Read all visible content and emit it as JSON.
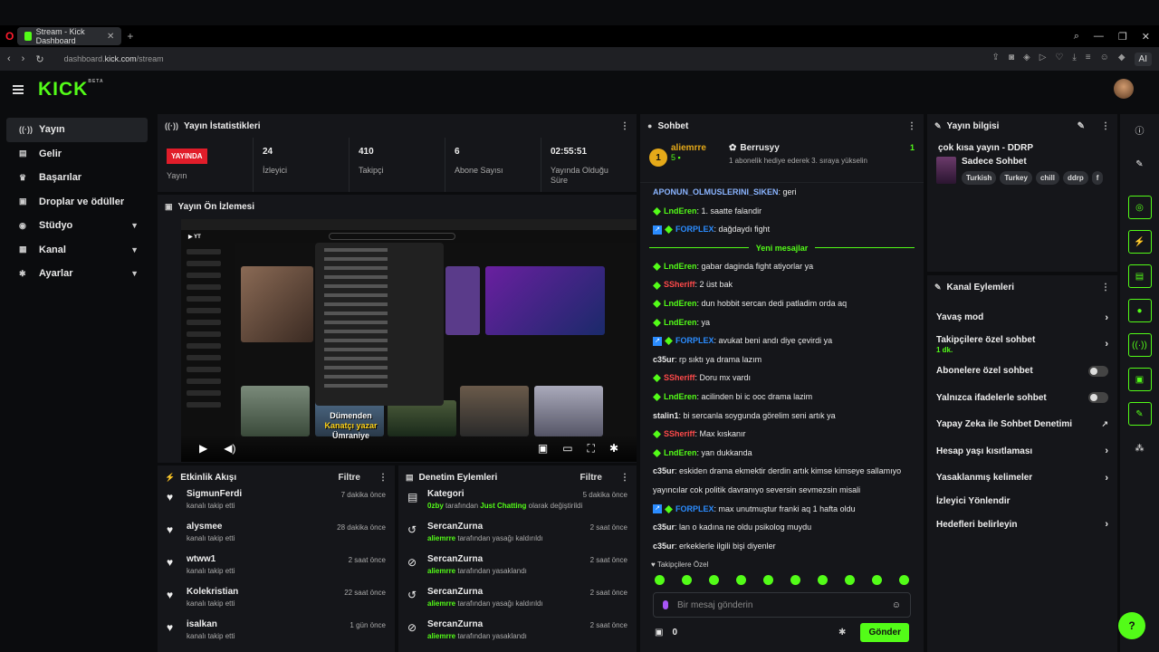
{
  "browser": {
    "tab_title": "Stream - Kick Dashboard",
    "url_prefix": "dashboard.",
    "url_domain": "kick.com",
    "url_path": "/stream",
    "ai_label": "AI"
  },
  "app": {
    "logo": "KICK",
    "logo_sup": "BETA"
  },
  "sidebar": {
    "items": [
      {
        "label": "Yayın",
        "icon": "broadcast-icon"
      },
      {
        "label": "Gelir",
        "icon": "revenue-icon"
      },
      {
        "label": "Başarılar",
        "icon": "trophy-icon"
      },
      {
        "label": "Droplar ve ödüller",
        "icon": "gift-icon"
      },
      {
        "label": "Stüdyo",
        "icon": "studio-icon"
      },
      {
        "label": "Kanal",
        "icon": "channel-icon"
      },
      {
        "label": "Ayarlar",
        "icon": "gear-icon"
      }
    ]
  },
  "stats": {
    "title": "Yayın İstatistikleri",
    "live_badge": "YAYINDA",
    "live_label": "Yayın",
    "viewers_value": "24",
    "viewers_label": "İzleyici",
    "followers_value": "410",
    "followers_label": "Takipçi",
    "subs_value": "6",
    "subs_label": "Abone Sayısı",
    "duration_value": "02:55:51",
    "duration_label": "Yayında Olduğu Süre"
  },
  "preview": {
    "title": "Yayın Ön İzlemesi",
    "overlay_line1": "Dümenden",
    "overlay_line2": "Kanatçı yazar",
    "overlay_line3": "Ümraniye"
  },
  "activity": {
    "title": "Etkinlik Akışı",
    "filter": "Filtre",
    "items": [
      {
        "name": "SigmunFerdi",
        "sub": "kanalı takip etti",
        "time": "7 dakika önce"
      },
      {
        "name": "alysmee",
        "sub": "kanalı takip etti",
        "time": "28 dakika önce"
      },
      {
        "name": "wtww1",
        "sub": "kanalı takip etti",
        "time": "2 saat önce"
      },
      {
        "name": "Kolekristian",
        "sub": "kanalı takip etti",
        "time": "22 saat önce"
      },
      {
        "name": "isalkan",
        "sub": "kanalı takip etti",
        "time": "1 gün önce"
      }
    ]
  },
  "moderation": {
    "title": "Denetim Eylemleri",
    "filter": "Filtre",
    "items": [
      {
        "name": "Kategori",
        "actor": "0zby",
        "mid": "tarafından",
        "target": "Just Chatting",
        "rest": "olarak değiştirildi",
        "time": "5 dakika önce"
      },
      {
        "name": "SercanZurna",
        "actor": "aliemrre",
        "mid": "tarafından yasağı kaldırıldı",
        "target": "",
        "rest": "",
        "time": "2 saat önce"
      },
      {
        "name": "SercanZurna",
        "actor": "aliemrre",
        "mid": "tarafından yasaklandı",
        "target": "",
        "rest": "",
        "time": "2 saat önce"
      },
      {
        "name": "SercanZurna",
        "actor": "aliemrre",
        "mid": "tarafından yasağı kaldırıldı",
        "target": "",
        "rest": "",
        "time": "2 saat önce"
      },
      {
        "name": "SercanZurna",
        "actor": "aliemrre",
        "mid": "tarafından yasaklandı",
        "target": "",
        "rest": "",
        "time": "2 saat önce"
      }
    ]
  },
  "chat": {
    "title": "Sohbet",
    "pin_rank": "1",
    "pin_user": "aliemrre",
    "pin_user_count": "5",
    "pin_gifter": "Berrusyy",
    "pin_gifter_count": "1",
    "pin_text": "1 abonelik hediye ederek 3. sıraya yükselin",
    "new_messages": "Yeni mesajlar",
    "followers_only": "Takipçilere Özel",
    "placeholder": "Bir mesaj gönderin",
    "gift_count": "0",
    "send": "Gönder",
    "messages_before": [
      {
        "user": "APONUN_OLMUSLERINI_SIKEN",
        "color": "u-cyan",
        "badges": "",
        "text": "geri"
      },
      {
        "user": "LndEren",
        "color": "u-green",
        "badges": "g",
        "text": "1. saatte falandir"
      },
      {
        "user": "FORPLEX",
        "color": "u-blue",
        "badges": "bg",
        "text": "dağdaydı fight"
      }
    ],
    "messages_after": [
      {
        "user": "LndEren",
        "color": "u-green",
        "badges": "g",
        "text": "gabar daginda fight atiyorlar ya"
      },
      {
        "user": "SSheriff",
        "color": "u-red",
        "badges": "g",
        "text": "2 üst bak"
      },
      {
        "user": "LndEren",
        "color": "u-green",
        "badges": "g",
        "text": "dun hobbit sercan dedi patladim orda aq"
      },
      {
        "user": "LndEren",
        "color": "u-green",
        "badges": "g",
        "text": "ya"
      },
      {
        "user": "FORPLEX",
        "color": "u-blue",
        "badges": "bg",
        "text": "avukat beni andı diye çevirdi ya"
      },
      {
        "user": "c35ur",
        "color": "u-white",
        "badges": "",
        "text": "rp sıktı ya drama lazım"
      },
      {
        "user": "SSheriff",
        "color": "u-red",
        "badges": "g",
        "text": "Doru mx vardı"
      },
      {
        "user": "LndEren",
        "color": "u-green",
        "badges": "g",
        "text": "acilinden bi ic ooc drama lazim"
      },
      {
        "user": "stalin1",
        "color": "u-white",
        "badges": "",
        "text": "bi sercanla soygunda görelim seni artık ya"
      },
      {
        "user": "SSheriff",
        "color": "u-red",
        "badges": "g",
        "text": "Max kıskanır"
      },
      {
        "user": "LndEren",
        "color": "u-green",
        "badges": "g",
        "text": "yan dukkanda"
      },
      {
        "user": "c35ur",
        "color": "u-white",
        "badges": "",
        "text": "eskiden drama ekmektir derdin artık kimse kimseye sallamıyo"
      },
      {
        "user": "",
        "color": "u-white",
        "badges": "",
        "text": "yayıncılar cok politik davranıyo seversin sevmezsin misali"
      },
      {
        "user": "FORPLEX",
        "color": "u-blue",
        "badges": "bg",
        "text": "max unutmuştur franki aq 1 hafta oldu"
      },
      {
        "user": "c35ur",
        "color": "u-white",
        "badges": "",
        "text": "lan o kadına ne oldu psikolog muydu"
      },
      {
        "user": "c35ur",
        "color": "u-white",
        "badges": "",
        "text": "erkeklerle ilgili bişi diyenler"
      }
    ]
  },
  "stream_info": {
    "title": "Yayın bilgisi",
    "stream_title": "çok kısa yayın - DDRP",
    "category": "Sadece Sohbet",
    "tags": [
      "Turkish",
      "Turkey",
      "chill",
      "ddrp",
      "f"
    ]
  },
  "channel_actions": {
    "title": "Kanal Eylemleri",
    "items": [
      {
        "label": "Yavaş mod",
        "sub": "",
        "control": "chevron"
      },
      {
        "label": "Takipçilere özel sohbet",
        "sub": "1 dk.",
        "control": "chevron"
      },
      {
        "label": "Abonelere özel sohbet",
        "sub": "",
        "control": "toggle"
      },
      {
        "label": "Yalnızca ifadelerle sohbet",
        "sub": "",
        "control": "toggle"
      },
      {
        "label": "Yapay Zeka ile Sohbet Denetimi",
        "sub": "",
        "control": "external"
      },
      {
        "label": "Hesap yaşı kısıtlaması",
        "sub": "",
        "control": "chevron"
      },
      {
        "label": "Yasaklanmış kelimeler",
        "sub": "",
        "control": "chevron"
      },
      {
        "label": "İzleyici Yönlendir",
        "sub": "",
        "control": "none"
      },
      {
        "label": "Hedefleri belirleyin",
        "sub": "",
        "control": "chevron"
      }
    ]
  },
  "colors": {
    "accent": "#53fc18",
    "live": "#e11d2a",
    "panel": "#15161a"
  }
}
